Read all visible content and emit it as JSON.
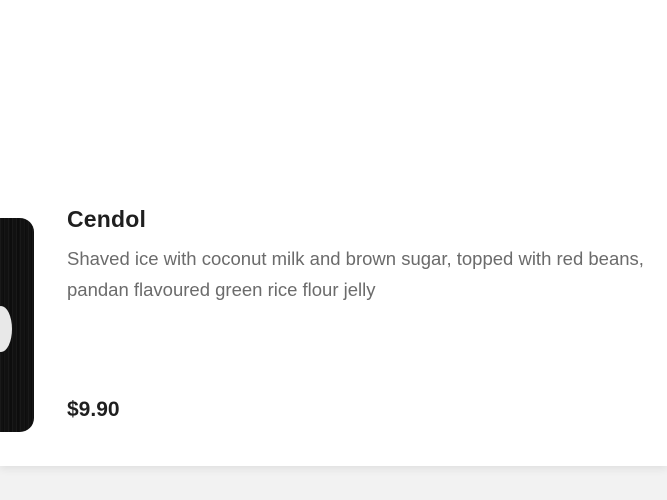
{
  "item": {
    "name": "Cendol",
    "description": "Shaved ice with coconut milk and brown sugar, topped with red beans, pandan flavoured green rice flour jelly",
    "price": "$9.90"
  }
}
